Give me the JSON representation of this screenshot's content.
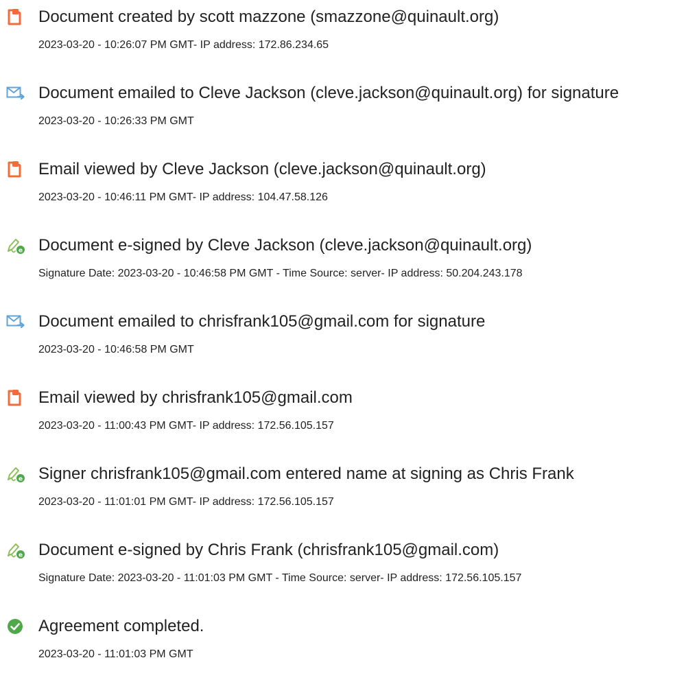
{
  "events": [
    {
      "icon": "document-created-icon",
      "title": "Document created by scott mazzone (smazzone@quinault.org)",
      "detail": "2023-03-20 - 10:26:07 PM GMT- IP address: 172.86.234.65"
    },
    {
      "icon": "email-sent-icon",
      "title": "Document emailed to Cleve Jackson (cleve.jackson@quinault.org) for signature",
      "detail": "2023-03-20 - 10:26:33 PM GMT"
    },
    {
      "icon": "document-viewed-icon",
      "title": "Email viewed by Cleve Jackson (cleve.jackson@quinault.org)",
      "detail": "2023-03-20 - 10:46:11 PM GMT- IP address: 104.47.58.126"
    },
    {
      "icon": "e-sign-pen-icon",
      "title": "Document e-signed by Cleve Jackson (cleve.jackson@quinault.org)",
      "detail": "Signature Date: 2023-03-20 - 10:46:58 PM GMT - Time Source: server- IP address: 50.204.243.178"
    },
    {
      "icon": "email-sent-icon",
      "title": "Document emailed to chrisfrank105@gmail.com for signature",
      "detail": "2023-03-20 - 10:46:58 PM GMT"
    },
    {
      "icon": "document-viewed-icon",
      "title": "Email viewed by chrisfrank105@gmail.com",
      "detail": "2023-03-20 - 11:00:43 PM GMT- IP address: 172.56.105.157"
    },
    {
      "icon": "e-sign-pen-icon",
      "title": "Signer chrisfrank105@gmail.com entered name at signing as Chris Frank",
      "detail": "2023-03-20 - 11:01:01 PM GMT- IP address: 172.56.105.157"
    },
    {
      "icon": "e-sign-pen-icon",
      "title": "Document e-signed by Chris Frank (chrisfrank105@gmail.com)",
      "detail": "Signature Date: 2023-03-20 - 11:01:03 PM GMT - Time Source: server- IP address: 172.56.105.157"
    },
    {
      "icon": "checkmark-complete-icon",
      "title": "Agreement completed.",
      "detail": "2023-03-20 - 11:01:03 PM GMT"
    }
  ],
  "colors": {
    "document_icon": "#f26b3a",
    "email_icon": "#5fa4d9",
    "pen_icon": "#8fbf5a",
    "complete_icon": "#4fa84a",
    "text": "#222222"
  }
}
